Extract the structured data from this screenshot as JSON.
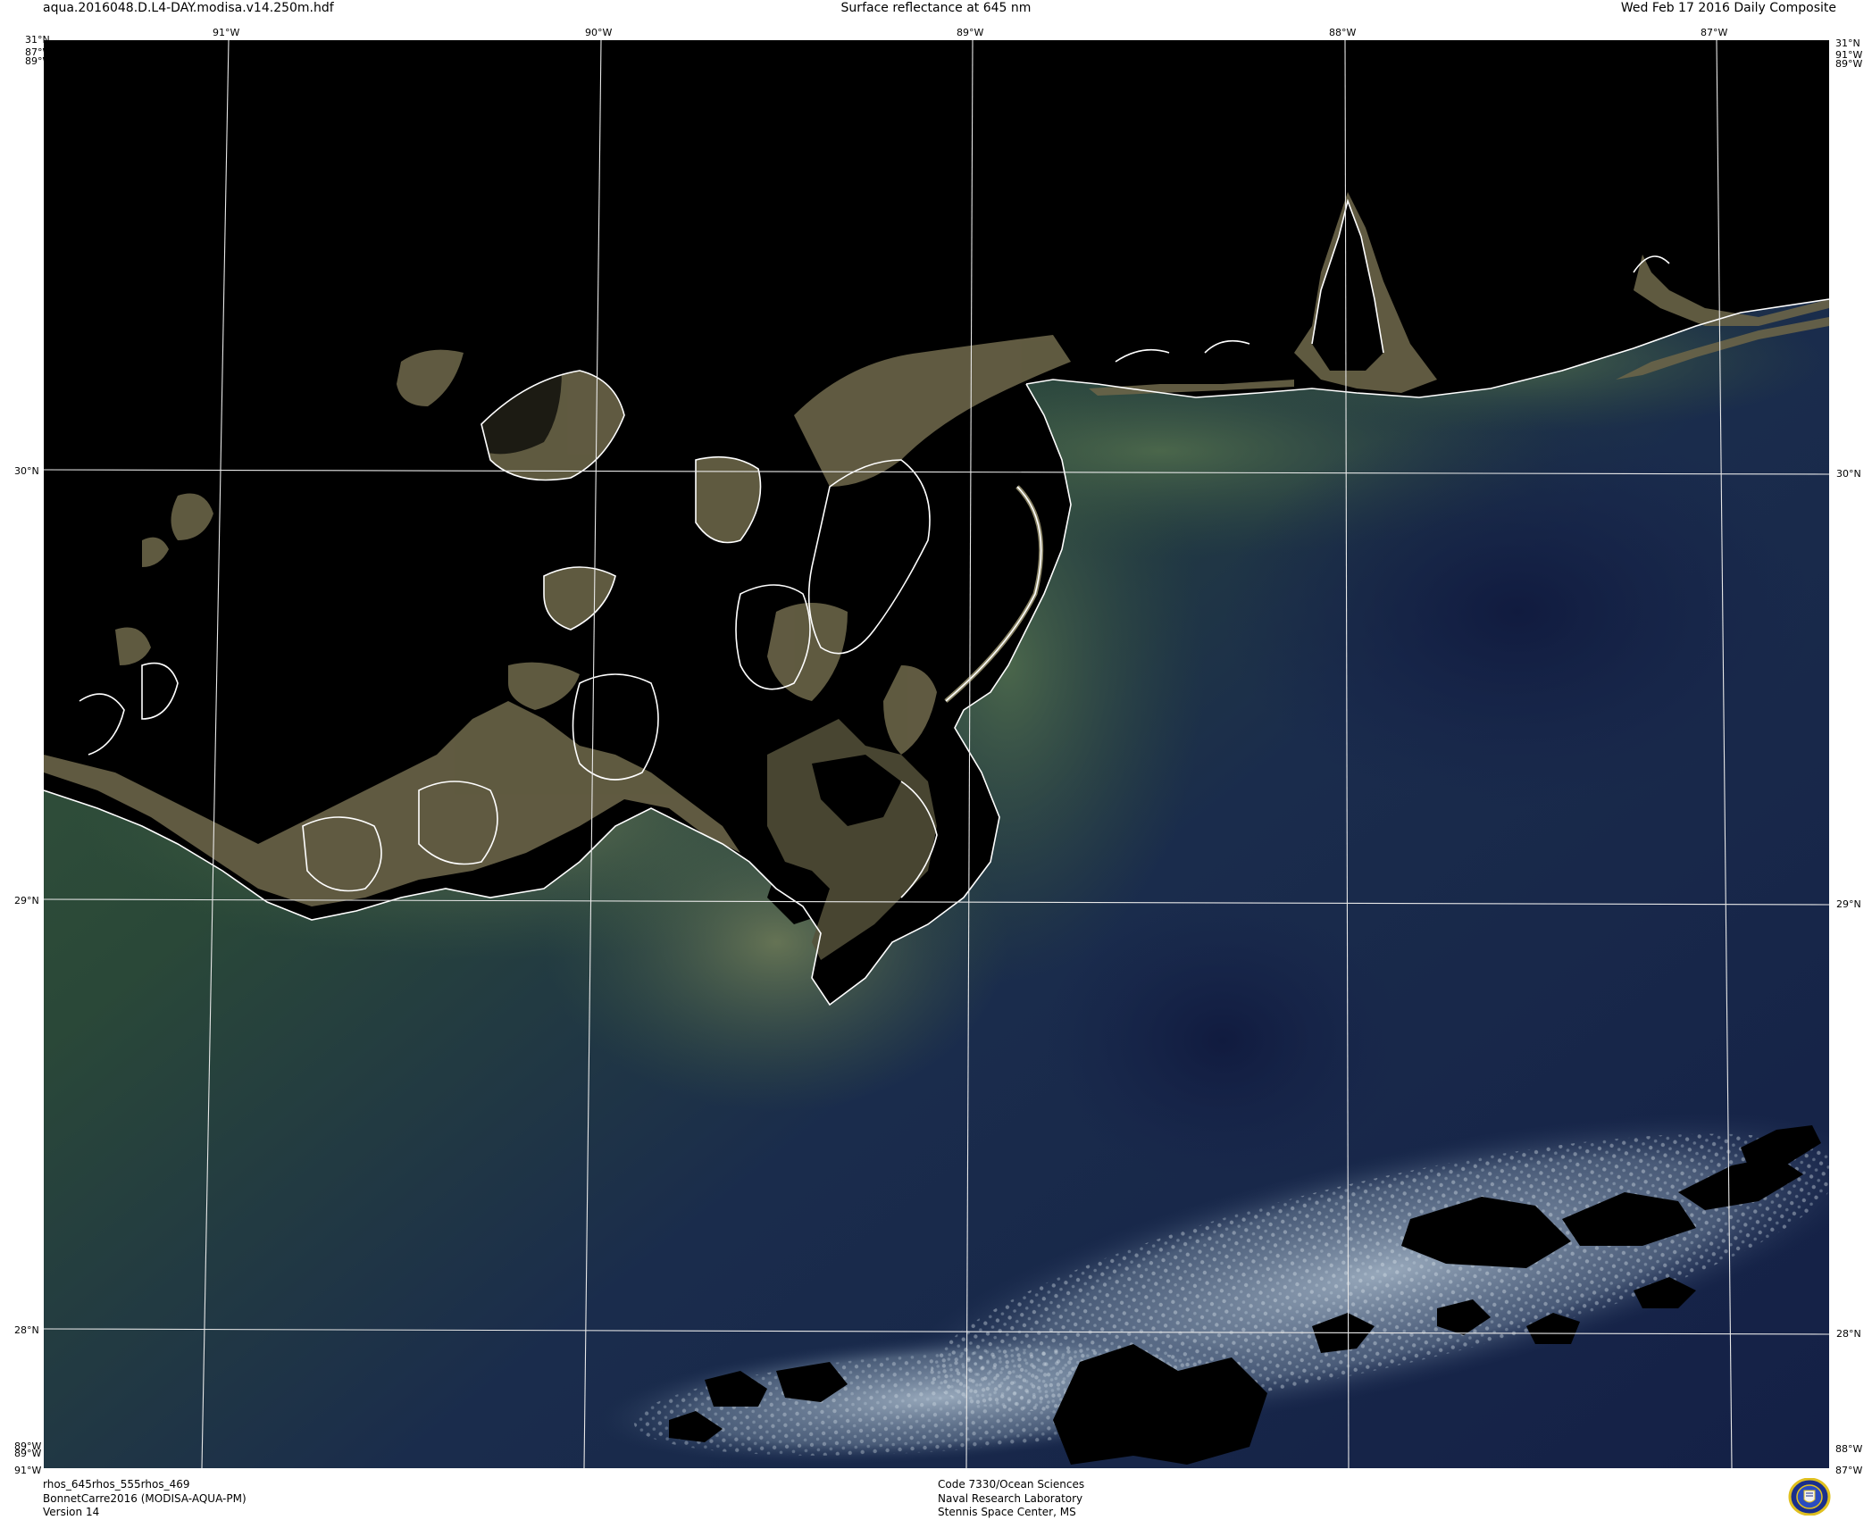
{
  "header": {
    "filename": "aqua.2016048.D.L4-DAY.modisa.v14.250m.hdf",
    "title": "Surface reflectance at 645 nm",
    "date": "Wed Feb 17 2016 Daily Composite"
  },
  "corners": {
    "top_left_lat": "31°N",
    "top_left_lon_a": "87°W",
    "top_left_lon_b": "89°W",
    "top_right_lat": "31°N",
    "top_right_lon_a": "91°W",
    "top_right_lon_b": "89°W",
    "bottom_left_lon_a": "89°W",
    "bottom_left_lon_b": "89°W",
    "bottom_left_lon_c": "91°W",
    "bottom_right_lon_a": "88°W",
    "bottom_right_lon_b": "87°W"
  },
  "longitudes_top": [
    "91°W",
    "90°W",
    "89°W",
    "88°W",
    "87°W"
  ],
  "latitudes_left": [
    "30°N",
    "29°N",
    "28°N"
  ],
  "latitudes_right": [
    "30°N",
    "29°N",
    "28°N"
  ],
  "footer": {
    "left": [
      "rhos_645rhos_555rhos_469",
      "BonnetCarre2016 (MODISA-AQUA-PM)",
      "Version 14"
    ],
    "center": [
      "Code 7330/Ocean Sciences",
      "Naval Research Laboratory",
      "Stennis Space Center, MS"
    ]
  },
  "colors": {
    "land": "#000000",
    "sediment": "#6e6a4e",
    "turbid_water": "#3e5a3e",
    "open_water": "#15204a",
    "clouds": "#c8d6e0",
    "coastline": "#ffffff",
    "grid": "#ffffff"
  },
  "logo": "naval-research-laboratory-seal"
}
